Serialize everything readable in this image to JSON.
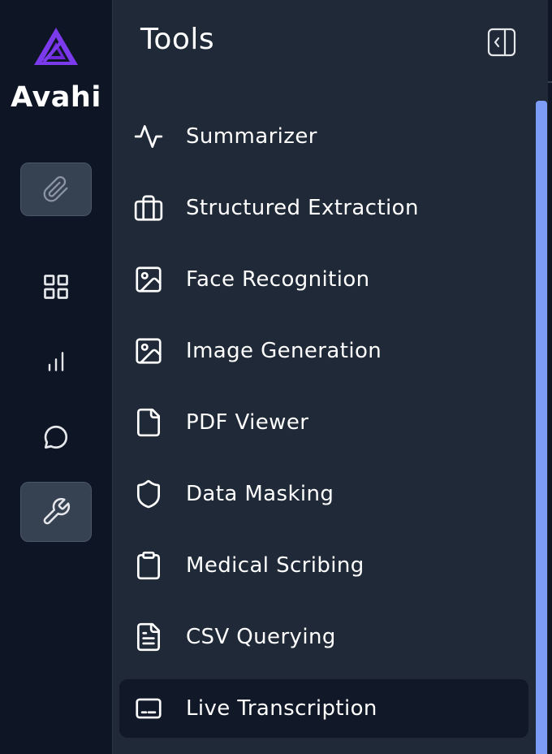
{
  "brand": {
    "name": "Avahi",
    "logo_icon": "avahi-triangle-logo",
    "logo_color": "#7c3aed"
  },
  "rail": {
    "items": [
      {
        "id": "attach",
        "icon": "paperclip-icon",
        "boxed": true
      },
      {
        "id": "dashboard",
        "icon": "grid-icon",
        "boxed": false
      },
      {
        "id": "analytics",
        "icon": "bar-chart-icon",
        "boxed": false
      },
      {
        "id": "chat",
        "icon": "chat-bubble-icon",
        "boxed": false
      },
      {
        "id": "tools",
        "icon": "wrench-icon",
        "boxed": true
      }
    ]
  },
  "panel": {
    "title": "Tools",
    "collapse_icon": "panel-collapse-icon",
    "items": [
      {
        "label": "Summarizer",
        "icon": "activity-icon",
        "active": false
      },
      {
        "label": "Structured Extraction",
        "icon": "briefcase-icon",
        "active": false
      },
      {
        "label": "Face Recognition",
        "icon": "image-icon",
        "active": false
      },
      {
        "label": "Image Generation",
        "icon": "image-icon",
        "active": false
      },
      {
        "label": "PDF Viewer",
        "icon": "file-icon",
        "active": false
      },
      {
        "label": "Data Masking",
        "icon": "shield-icon",
        "active": false
      },
      {
        "label": "Medical Scribing",
        "icon": "clipboard-icon",
        "active": false
      },
      {
        "label": "CSV Querying",
        "icon": "file-text-icon",
        "active": false
      },
      {
        "label": "Live Transcription",
        "icon": "captions-icon",
        "active": true
      }
    ]
  },
  "colors": {
    "rail_bg": "#0e1625",
    "panel_bg": "#1f2937",
    "active_item_bg": "#111827",
    "rail_button_bg": "#364152",
    "scrollbar": "#7c9cf5",
    "text": "#ffffff"
  }
}
